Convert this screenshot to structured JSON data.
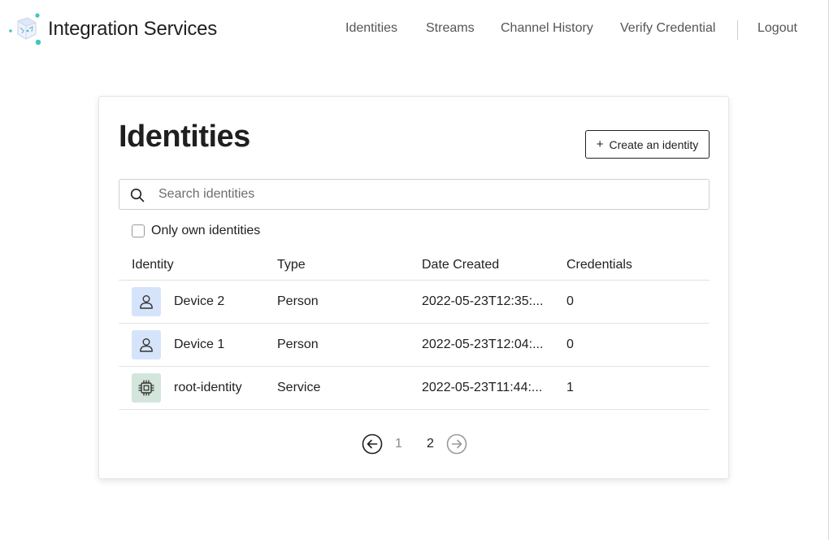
{
  "app": {
    "brand": "Integration Services"
  },
  "nav": {
    "items": [
      {
        "label": "Identities"
      },
      {
        "label": "Streams"
      },
      {
        "label": "Channel History"
      },
      {
        "label": "Verify Credential"
      },
      {
        "label": "Logout"
      }
    ]
  },
  "page": {
    "title": "Identities",
    "create_button": "Create an identity",
    "search": {
      "placeholder": "Search identities",
      "value": ""
    },
    "filter": {
      "label": "Only own identities",
      "checked": false
    }
  },
  "table": {
    "columns": [
      "Identity",
      "Type",
      "Date Created",
      "Credentials"
    ],
    "rows": [
      {
        "name": "Device 2",
        "type": "Person",
        "date": "2022-05-23T12:35:...",
        "credentials": "0",
        "icon": "person-icon"
      },
      {
        "name": "Device 1",
        "type": "Person",
        "date": "2022-05-23T12:04:...",
        "credentials": "0",
        "icon": "person-icon"
      },
      {
        "name": "root-identity",
        "type": "Service",
        "date": "2022-05-23T11:44:...",
        "credentials": "1",
        "icon": "chip-icon"
      }
    ]
  },
  "pagination": {
    "pages": [
      "1",
      "2"
    ],
    "current": "2",
    "prev_icon": "arrow-left-circle-icon",
    "next_icon": "arrow-right-circle-icon"
  },
  "colors": {
    "person_avatar_bg": "#d6e4fb",
    "service_avatar_bg": "#d4e6dc",
    "logo_accent": "#3ec6c1"
  }
}
